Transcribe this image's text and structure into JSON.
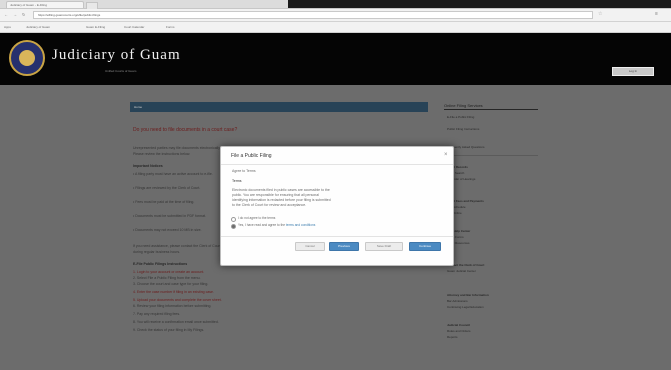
{
  "browser": {
    "tab_title": "Judiciary of Guam - E-Filing",
    "nav_back": "←",
    "nav_forward": "→",
    "nav_reload": "↻",
    "url": "https://efiling.guamcourts.org/efile/public-filings",
    "star": "☆",
    "menu": "≡",
    "bookmarks": [
      "Apps",
      "Judiciary of Guam",
      "Guam E-Filing",
      "Court Calendar",
      "Forms"
    ]
  },
  "header": {
    "brand": "Judiciary of Guam",
    "subtitle": "Unified Courts of Guam",
    "login_label": "Log In"
  },
  "content": {
    "bar_label": "Home",
    "red_heading": "Do you need to file documents in a court case?",
    "lines": [
      "Unrepresented parties may file documents electronically.",
      "Please review the instructions below.",
      "Important Notices",
      "• A filing party must have an active account to e-file.",
      "• Filings are reviewed by the Clerk of Court.",
      "• Fees must be paid at the time of filing.",
      "• Documents must be submitted in PDF format.",
      "• Documents may not exceed 10 MB in size.",
      "If you need assistance, please contact the Clerk of Court",
      "during regular business hours.",
      "E-File Public Filings Instructions",
      "1. Login to your account or create an account.",
      "2. Select File a Public Filing from the menu.",
      "3. Choose the court and case type for your filing.",
      "4. Enter the case number if filing in an existing case.",
      "5. Upload your documents and complete the cover sheet.",
      "6. Review your filing information before submitting.",
      "7. Pay any required filing fees.",
      "8. You will receive a confirmation email once submitted.",
      "9. Check the status of your filing in My Filings."
    ]
  },
  "sidebar": {
    "title": "Online Filing Services",
    "items": [
      "E-File a Public Filing",
      "Public Filing Instructions",
      "Frequently Asked Questions",
      "Court Records",
      "Case Search",
      "Calendar of Hearings",
      "Court Fees and Payments",
      "Fee Schedule",
      "Pay Online",
      "Self-Help Center",
      "Court Forms",
      "Legal Resources",
      "Contact the Clerk of Court",
      "Guam Judicial Center",
      "Attorney and Bar Information",
      "Bar Admissions",
      "Continuing Legal Education",
      "Judicial Council",
      "Rules and Orders",
      "Reports"
    ]
  },
  "modal": {
    "title": "File a Public Filing",
    "close": "×",
    "section": "Agree to Terms",
    "subsection": "Terms",
    "body": [
      "Electronic documents filed in public cases are accessible to the",
      "public. You are responsible for ensuring that all personal",
      "identifying information is redacted before your filing is submitted",
      "to the Clerk of Court for review and acceptance."
    ],
    "option_disagree": "I do not agree to the terms",
    "option_agree_pre": "Yes, I have read and agree to the ",
    "option_agree_link": "terms and conditions",
    "buttons": [
      "Cancel",
      "Previous",
      "Save Draft",
      "Continue"
    ]
  }
}
